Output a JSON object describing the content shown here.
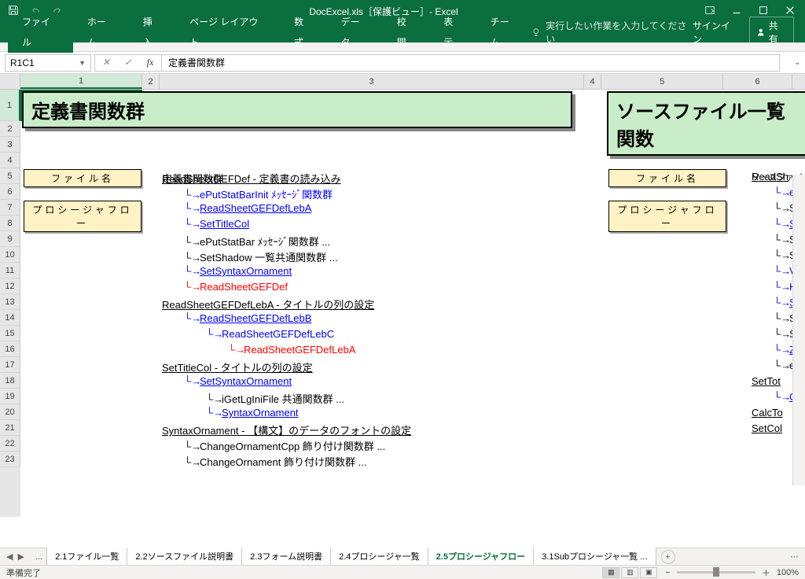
{
  "titlebar": {
    "title": "DocExcel.xls［保護ビュー］- Excel"
  },
  "ribbon": {
    "tabs": [
      "ファイル",
      "ホーム",
      "挿入",
      "ページ レイアウト",
      "数式",
      "データ",
      "校閲",
      "表示",
      "チーム"
    ],
    "tellme": "実行したい作業を入力してください",
    "signin": "サインイン",
    "share": "共有"
  },
  "formula": {
    "namebox": "R1C1",
    "value": "定義書関数群"
  },
  "columns": [
    "1",
    "2",
    "3",
    "4",
    "5",
    "6"
  ],
  "rows": [
    "1",
    "2",
    "3",
    "4",
    "5",
    "6",
    "7",
    "8",
    "9",
    "10",
    "11",
    "12",
    "13",
    "14",
    "15",
    "16",
    "17",
    "18",
    "19",
    "20",
    "21",
    "22",
    "23"
  ],
  "titles": {
    "left": "定義書関数群",
    "right": "ソースファイル一覧関数"
  },
  "labels": {
    "filename": "ファイル名",
    "procflow": "プロシージャフロー"
  },
  "col3_plain": {
    "filename_value": "定義書関数群"
  },
  "col3_tree": [
    {
      "row": 5,
      "indent": 0,
      "text": "ReadSheetGEFDef - 定義書の読み込み",
      "class": "underline"
    },
    {
      "row": 6,
      "indent": 1,
      "arrow": "blue",
      "text": "ePutStatBarInit ﾒｯｾｰｼﾞ関数群",
      "class": "blue"
    },
    {
      "row": 7,
      "indent": 1,
      "arrow": "blue",
      "text": "ReadSheetGEFDefLebA",
      "class": "blue underline"
    },
    {
      "row": 8,
      "indent": 1,
      "arrow": "blue",
      "text": "SetTitleCol",
      "class": "blue underline"
    },
    {
      "row": 9,
      "indent": 1,
      "arrow": "black",
      "text": "ePutStatBar ﾒｯｾｰｼﾞ関数群 ...",
      "class": ""
    },
    {
      "row": 10,
      "indent": 1,
      "arrow": "black",
      "text": "SetShadow 一覧共通関数群 ...",
      "class": ""
    },
    {
      "row": 11,
      "indent": 1,
      "arrow": "blue",
      "text": "SetSyntaxOrnament",
      "class": "blue underline"
    },
    {
      "row": 12,
      "indent": 1,
      "arrow": "red",
      "text": "ReadSheetGEFDef <R>",
      "class": "red"
    },
    {
      "row": 13,
      "indent": 0,
      "text": "ReadSheetGEFDefLebA - タイトルの列の設定",
      "class": "underline"
    },
    {
      "row": 14,
      "indent": 1,
      "arrow": "blue",
      "text": "ReadSheetGEFDefLebB",
      "class": "blue underline"
    },
    {
      "row": 15,
      "indent": 2,
      "arrow": "blue",
      "text": "ReadSheetGEFDefLebC",
      "class": "blue"
    },
    {
      "row": 16,
      "indent": 3,
      "arrow": "red",
      "text": "ReadSheetGEFDefLebA <R>",
      "class": "red"
    },
    {
      "row": 17,
      "indent": 0,
      "text": "SetTitleCol - タイトルの列の設定",
      "class": "underline"
    },
    {
      "row": 18,
      "indent": 1,
      "arrow": "blue",
      "text": "SetSyntaxOrnament",
      "class": "blue underline"
    },
    {
      "row": 19,
      "indent": 2,
      "arrow": "black",
      "text": "iGetLgIniFile 共通関数群 ...",
      "class": ""
    },
    {
      "row": 20,
      "indent": 2,
      "arrow": "blue",
      "text": "SyntaxOrnament",
      "class": "blue underline"
    },
    {
      "row": 21,
      "indent": 0,
      "text": "SyntaxOrnament - 【構文】のデータのフォントの設定",
      "class": "underline"
    },
    {
      "row": 22,
      "indent": 1,
      "arrow": "black",
      "text": "ChangeOrnamentCpp 飾り付け関数群 ...",
      "class": ""
    },
    {
      "row": 23,
      "indent": 1,
      "arrow": "black",
      "text": "ChangeOrnament 飾り付け関数群 ...",
      "class": ""
    }
  ],
  "col6_plain": {
    "filename_value": "ソースファイ"
  },
  "col6_tree": [
    {
      "row": 5,
      "indent": 0,
      "text": "ReadSh",
      "class": "underline"
    },
    {
      "row": 6,
      "indent": 1,
      "arrow": "blue",
      "text": "eP",
      "class": "blue"
    },
    {
      "row": 7,
      "indent": 1,
      "arrow": "black",
      "text": "Se",
      "class": ""
    },
    {
      "row": 8,
      "indent": 1,
      "arrow": "blue",
      "text": "Se",
      "class": "blue underline"
    },
    {
      "row": 9,
      "indent": 1,
      "arrow": "black",
      "text": "Se",
      "class": ""
    },
    {
      "row": 10,
      "indent": 1,
      "arrow": "black",
      "text": "Se",
      "class": ""
    },
    {
      "row": 11,
      "indent": 1,
      "arrow": "blue",
      "text": "VD",
      "class": "blue"
    },
    {
      "row": 12,
      "indent": 1,
      "arrow": "blue",
      "text": "HD",
      "class": "blue"
    },
    {
      "row": 13,
      "indent": 1,
      "arrow": "blue",
      "text": "Se",
      "class": "blue underline"
    },
    {
      "row": 14,
      "indent": 1,
      "arrow": "black",
      "text": "Se",
      "class": ""
    },
    {
      "row": 15,
      "indent": 1,
      "arrow": "black",
      "text": "Se",
      "class": ""
    },
    {
      "row": 16,
      "indent": 1,
      "arrow": "blue",
      "text": "ZZ",
      "class": "blue underline"
    },
    {
      "row": 17,
      "indent": 1,
      "arrow": "black",
      "text": "eP",
      "class": ""
    },
    {
      "row": 18,
      "indent": 0,
      "text": "SetTot",
      "class": "underline"
    },
    {
      "row": 19,
      "indent": 1,
      "arrow": "blue",
      "text": "Ca",
      "class": "blue underline"
    },
    {
      "row": 20,
      "indent": 0,
      "text": "CalcTo",
      "class": "underline"
    },
    {
      "row": 21,
      "indent": 0,
      "text": "SetCol",
      "class": "underline"
    }
  ],
  "sheets": {
    "tabs": [
      "2.1ファイル一覧",
      "2.2ソースファイル説明書",
      "2.3フォーム説明書",
      "2.4プロシージャ一覧",
      "2.5プロシージャフロー",
      "3.1Subプロシージャ一覧 ..."
    ],
    "active": 4
  },
  "status": {
    "ready": "準備完了",
    "zoom": "100%"
  }
}
